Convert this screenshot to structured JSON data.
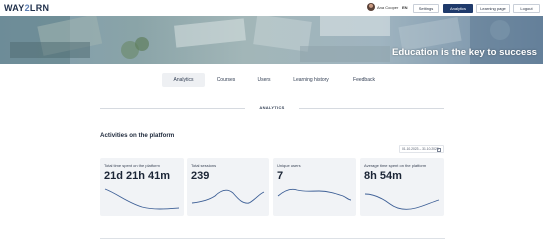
{
  "header": {
    "logo_left": "WAY",
    "logo_mid": "2",
    "logo_right": "LRN",
    "user_name": "Ana Cooper",
    "language": "EN",
    "nav": {
      "settings": "Settings",
      "analytics": "Analytics",
      "learning_page": "Learning page",
      "logout": "Logout"
    }
  },
  "banner": {
    "tagline": "Education is the key to success"
  },
  "tabs": [
    "Analytics",
    "Courses",
    "Users",
    "Learning history",
    "Feedback"
  ],
  "active_tab": "Analytics",
  "section": {
    "title": "ANALYTICS",
    "heading": "Activities on the platform",
    "date_range": "01.10.2023 – 31.10.2023"
  },
  "cards": [
    {
      "label": "Total time spent on the platform",
      "value": "21d 21h 41m"
    },
    {
      "label": "Total sessions",
      "value": "239"
    },
    {
      "label": "Unique users",
      "value": "7"
    },
    {
      "label": "Average time spent on the platform",
      "value": "8h 54m"
    }
  ],
  "colors": {
    "accent": "#1f3a6b",
    "sparkline": "#3d5f96",
    "card_bg": "#f1f3f6"
  }
}
